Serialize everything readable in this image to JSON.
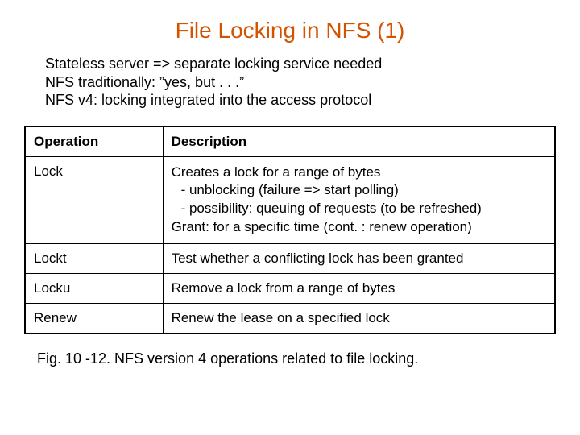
{
  "title": "File Locking in NFS (1)",
  "intro": {
    "line1": "Stateless server => separate locking service needed",
    "line2": "NFS traditionally: ”yes, but . . .”",
    "line3": "NFS v4:  locking integrated into the access protocol"
  },
  "table": {
    "headers": {
      "op": "Operation",
      "desc": "Description"
    },
    "rows": [
      {
        "op": "Lock",
        "desc_lines": [
          "Creates a lock for a range of bytes",
          " - unblocking (failure => start polling)",
          " - possibility: queuing of requests (to be refreshed)",
          "Grant: for a specific  time (cont. :  renew operation)"
        ]
      },
      {
        "op": "Lockt",
        "desc": "Test whether a conflicting lock has been granted"
      },
      {
        "op": "Locku",
        "desc": "Remove a lock from a range of bytes"
      },
      {
        "op": "Renew",
        "desc": "Renew the lease on a specified lock"
      }
    ]
  },
  "caption": "Fig. 10 -12.   NFS version 4 operations related to file locking."
}
